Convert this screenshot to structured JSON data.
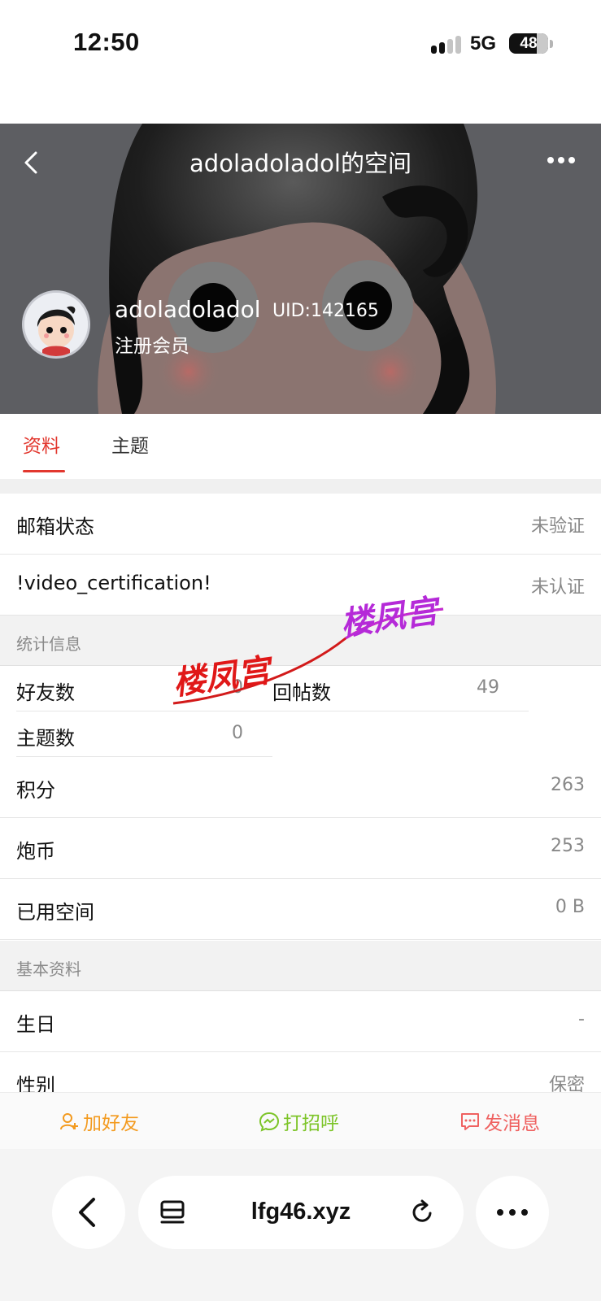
{
  "status_bar": {
    "time": "12:50",
    "network": "5G",
    "battery": "48"
  },
  "header": {
    "title": "adoladoladol的空间",
    "username": "adoladoladol",
    "uid": "UID:142165",
    "member_level": "注册会员"
  },
  "tabs": [
    {
      "label": "资料"
    },
    {
      "label": "主题"
    }
  ],
  "rows_top": [
    {
      "label": "邮箱状态",
      "value": "未验证"
    },
    {
      "label": "!video_certification!",
      "value": "未认证"
    }
  ],
  "stats_section": {
    "title": "统计信息",
    "friends_label": "好友数",
    "friends_value": "0",
    "replies_label": "回帖数",
    "replies_value": "49",
    "topics_label": "主题数",
    "topics_value": "0"
  },
  "rows_mid": [
    {
      "label": "积分",
      "value": "263"
    },
    {
      "label": "炮币",
      "value": "253"
    },
    {
      "label": "已用空间",
      "value": "0 B"
    }
  ],
  "basic_section": {
    "title": "基本资料"
  },
  "rows_basic": [
    {
      "label": "生日",
      "value": "-"
    },
    {
      "label": "性别",
      "value": "保密"
    }
  ],
  "watermark": {
    "text": "楼凤宫"
  },
  "actions": {
    "add_friend": "加好友",
    "greet": "打招呼",
    "message": "发消息"
  },
  "browser": {
    "url": "lfg46.xyz"
  },
  "colors": {
    "accent": "#e2372e",
    "add_friend": "#f39a1e",
    "greet": "#7cc427",
    "message": "#ef6160"
  }
}
